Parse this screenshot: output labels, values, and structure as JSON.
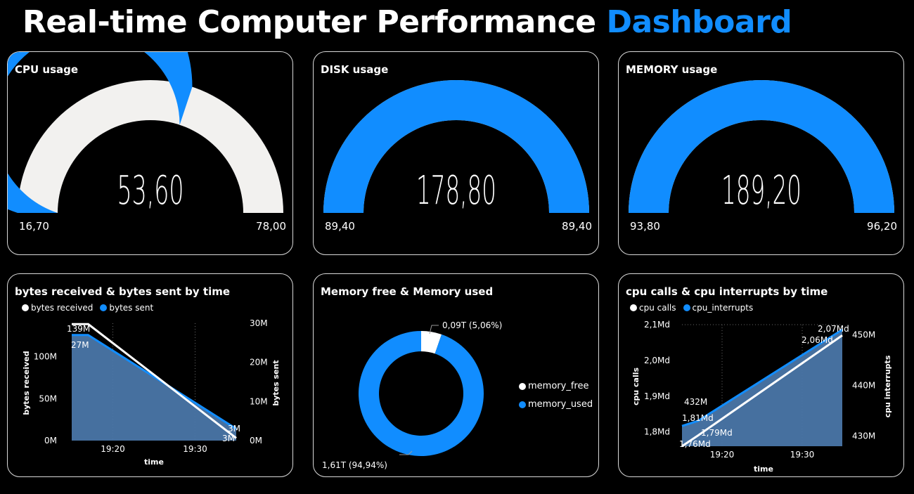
{
  "title": {
    "main": "Real-time Computer Performance",
    "accent": "Dashboard"
  },
  "colors": {
    "accent": "#118DFF",
    "track": "#F2F1EF",
    "area": "#4A76A8",
    "white": "#FFFFFF"
  },
  "gauges": [
    {
      "title": "CPU usage",
      "value_label": "53,60",
      "value": 53.6,
      "min_label": "16,70",
      "max_label": "78,00",
      "min": 16.7,
      "max": 78.0
    },
    {
      "title": "DISK usage",
      "value_label": "178,80",
      "value": 178.8,
      "min_label": "89,40",
      "max_label": "89,40",
      "min": 89.4,
      "max": 89.4
    },
    {
      "title": "MEMORY usage",
      "value_label": "189,20",
      "value": 189.2,
      "min_label": "93,80",
      "max_label": "96,20",
      "min": 93.8,
      "max": 96.2
    }
  ],
  "bytes_chart": {
    "title": "bytes received & bytes sent by time",
    "legend": [
      "bytes received",
      "bytes sent"
    ],
    "ylabel_left": "bytes received",
    "ylabel_right": "bytes sent",
    "xlabel": "time",
    "left_ticks": [
      "0M",
      "50M",
      "100M"
    ],
    "right_ticks": [
      "0M",
      "10M",
      "20M",
      "30M"
    ],
    "x_ticks": [
      "19:20",
      "19:30"
    ],
    "labels": [
      "139M",
      "27M",
      "3M",
      "3M"
    ]
  },
  "donut": {
    "title": "Memory free & Memory used",
    "legend": [
      "memory_free",
      "memory_used"
    ],
    "label_free": "0,09T (5,06%)",
    "label_used": "1,61T (94,94%)"
  },
  "cpu_chart": {
    "title": "cpu calls & cpu interrupts by time",
    "legend": [
      "cpu calls",
      "cpu_interrupts"
    ],
    "ylabel_left": "cpu calls",
    "ylabel_right": "cpu interrupts",
    "xlabel": "time",
    "left_ticks": [
      "1,8Md",
      "1,9Md",
      "2,0Md",
      "2,1Md"
    ],
    "right_ticks": [
      "430M",
      "440M",
      "450M"
    ],
    "x_ticks": [
      "19:20",
      "19:30"
    ],
    "labels": [
      "2,07Md",
      "2,06Md",
      "432M",
      "1,81Md",
      "1,79Md",
      "1,76Md"
    ]
  },
  "chart_data": [
    {
      "type": "gauge",
      "title": "CPU usage",
      "value": 53.6,
      "min": 16.7,
      "max": 78.0
    },
    {
      "type": "gauge",
      "title": "DISK usage",
      "value": 178.8,
      "min": 89.4,
      "max": 89.4
    },
    {
      "type": "gauge",
      "title": "MEMORY usage",
      "value": 189.2,
      "min": 93.8,
      "max": 96.2
    },
    {
      "type": "line",
      "title": "bytes received & bytes sent by time",
      "xlabel": "time",
      "ylabel": "bytes received",
      "y2label": "bytes sent",
      "x_ticks": [
        "19:20",
        "19:30"
      ],
      "ylim": [
        0,
        140000000
      ],
      "y2lim": [
        0,
        30000000
      ],
      "series": [
        {
          "name": "bytes received",
          "axis": "left",
          "x": [
            "19:15",
            "19:17",
            "19:35"
          ],
          "values": [
            139000000,
            139000000,
            3000000
          ]
        },
        {
          "name": "bytes sent",
          "axis": "right",
          "x": [
            "19:15",
            "19:17",
            "19:35"
          ],
          "values": [
            27000000,
            27000000,
            3000000
          ]
        }
      ]
    },
    {
      "type": "pie",
      "title": "Memory free & Memory used",
      "categories": [
        "memory_free",
        "memory_used"
      ],
      "values": [
        0.09,
        1.61
      ],
      "percent": [
        5.06,
        94.94
      ]
    },
    {
      "type": "line",
      "title": "cpu calls & cpu interrupts by time",
      "xlabel": "time",
      "ylabel": "cpu calls",
      "y2label": "cpu interrupts",
      "x_ticks": [
        "19:20",
        "19:30"
      ],
      "ylim": [
        1.76,
        2.1
      ],
      "y2lim": [
        428,
        452
      ],
      "series": [
        {
          "name": "cpu calls",
          "axis": "left",
          "x": [
            "19:15",
            "19:17",
            "19:35"
          ],
          "values": [
            1.76,
            1.79,
            2.07
          ]
        },
        {
          "name": "cpu_interrupts",
          "axis": "right",
          "x": [
            "19:15",
            "19:17",
            "19:35"
          ],
          "values": [
            432,
            433,
            451
          ]
        }
      ]
    }
  ]
}
